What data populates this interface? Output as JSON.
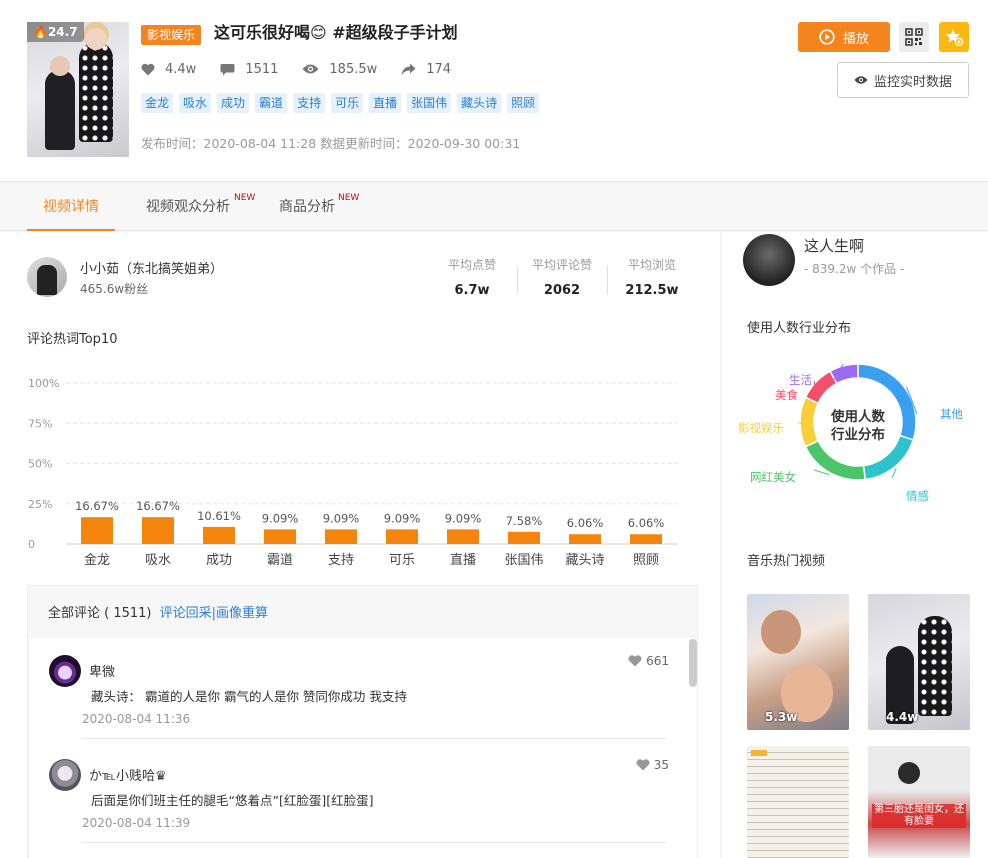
{
  "video": {
    "cover_badge": "24.7",
    "category": "影视娱乐",
    "title": "这可乐很好喝😊 #超级段子手计划",
    "stats": {
      "likes": "4.4w",
      "comments": "1511",
      "views": "185.5w",
      "shares": "174"
    },
    "tags": [
      "金龙",
      "吸水",
      "成功",
      "霸道",
      "支持",
      "可乐",
      "直播",
      "张国伟",
      "藏头诗",
      "照顾"
    ],
    "publish_time": "发布时间：2020-08-04 11:28 数据更新时间：2020-09-30 00:31"
  },
  "actions": {
    "play_label": "播放",
    "monitor_label": "监控实时数据"
  },
  "tabs": [
    {
      "label": "视频详情",
      "active": true,
      "badge": ""
    },
    {
      "label": "视频观众分析",
      "active": false,
      "badge": "NEW"
    },
    {
      "label": "商品分析",
      "active": false,
      "badge": "NEW"
    }
  ],
  "author": {
    "name": "小小茹（东北搞笑姐弟）",
    "fans": "465.6w粉丝",
    "metrics": [
      {
        "label": "平均点赞",
        "value": "6.7w"
      },
      {
        "label": "平均评论赞",
        "value": "2062"
      },
      {
        "label": "平均浏览",
        "value": "212.5w"
      }
    ]
  },
  "chart_title": "评论热词Top10",
  "chart_data": {
    "type": "bar",
    "title": "评论热词Top10",
    "categories": [
      "金龙",
      "吸水",
      "成功",
      "霸道",
      "支持",
      "可乐",
      "直播",
      "张国伟",
      "藏头诗",
      "照顾"
    ],
    "values": [
      16.67,
      16.67,
      10.61,
      9.09,
      9.09,
      9.09,
      9.09,
      7.58,
      6.06,
      6.06
    ],
    "value_labels": [
      "16.67%",
      "16.67%",
      "10.61%",
      "9.09%",
      "9.09%",
      "9.09%",
      "9.09%",
      "7.58%",
      "6.06%",
      "6.06%"
    ],
    "y_ticks": [
      "0",
      "25%",
      "50%",
      "75%",
      "100%"
    ],
    "ylim": [
      0,
      100
    ],
    "grid": true,
    "color": "#f5840c"
  },
  "comments": {
    "header_prefix": "全部评论 ( 1511)",
    "header_link": "评论回采|画像重算",
    "items": [
      {
        "name": "卑微",
        "text": "藏头诗：  霸道的人是你 霸气的人是你 赞同你成功 我支持",
        "time": "2020-08-04 11:36",
        "likes": "661"
      },
      {
        "name": "か℡小贱哈♛",
        "text": "后面是你们班主任的腿毛“悠着点”[红脸蛋][红脸蛋]",
        "time": "2020-08-04 11:39",
        "likes": "35"
      }
    ]
  },
  "sidebar": {
    "music_title": "这人生啊",
    "music_count": "- 839.2w 个作品 -",
    "industry_title": "使用人数行业分布",
    "donut_center": [
      "使用人数",
      "行业分布"
    ],
    "donut_segments": [
      {
        "label": "其他",
        "value": 30,
        "color": "#3a9fef"
      },
      {
        "label": "情感",
        "value": 18,
        "color": "#2bc4cc"
      },
      {
        "label": "网红美女",
        "value": 20,
        "color": "#4cc56a"
      },
      {
        "label": "影视娱乐",
        "value": 14,
        "color": "#f7d038"
      },
      {
        "label": "美食",
        "value": 10,
        "color": "#f2506a"
      },
      {
        "label": "生活",
        "value": 8,
        "color": "#9a6bf0"
      }
    ],
    "hot_title": "音乐热门视频",
    "hot_videos": [
      {
        "count": "5.3w"
      },
      {
        "count": "4.4w"
      },
      {
        "count": ""
      },
      {
        "count": ""
      }
    ],
    "thumb3_caption": "第三胎还是闺女，还有脸要"
  }
}
